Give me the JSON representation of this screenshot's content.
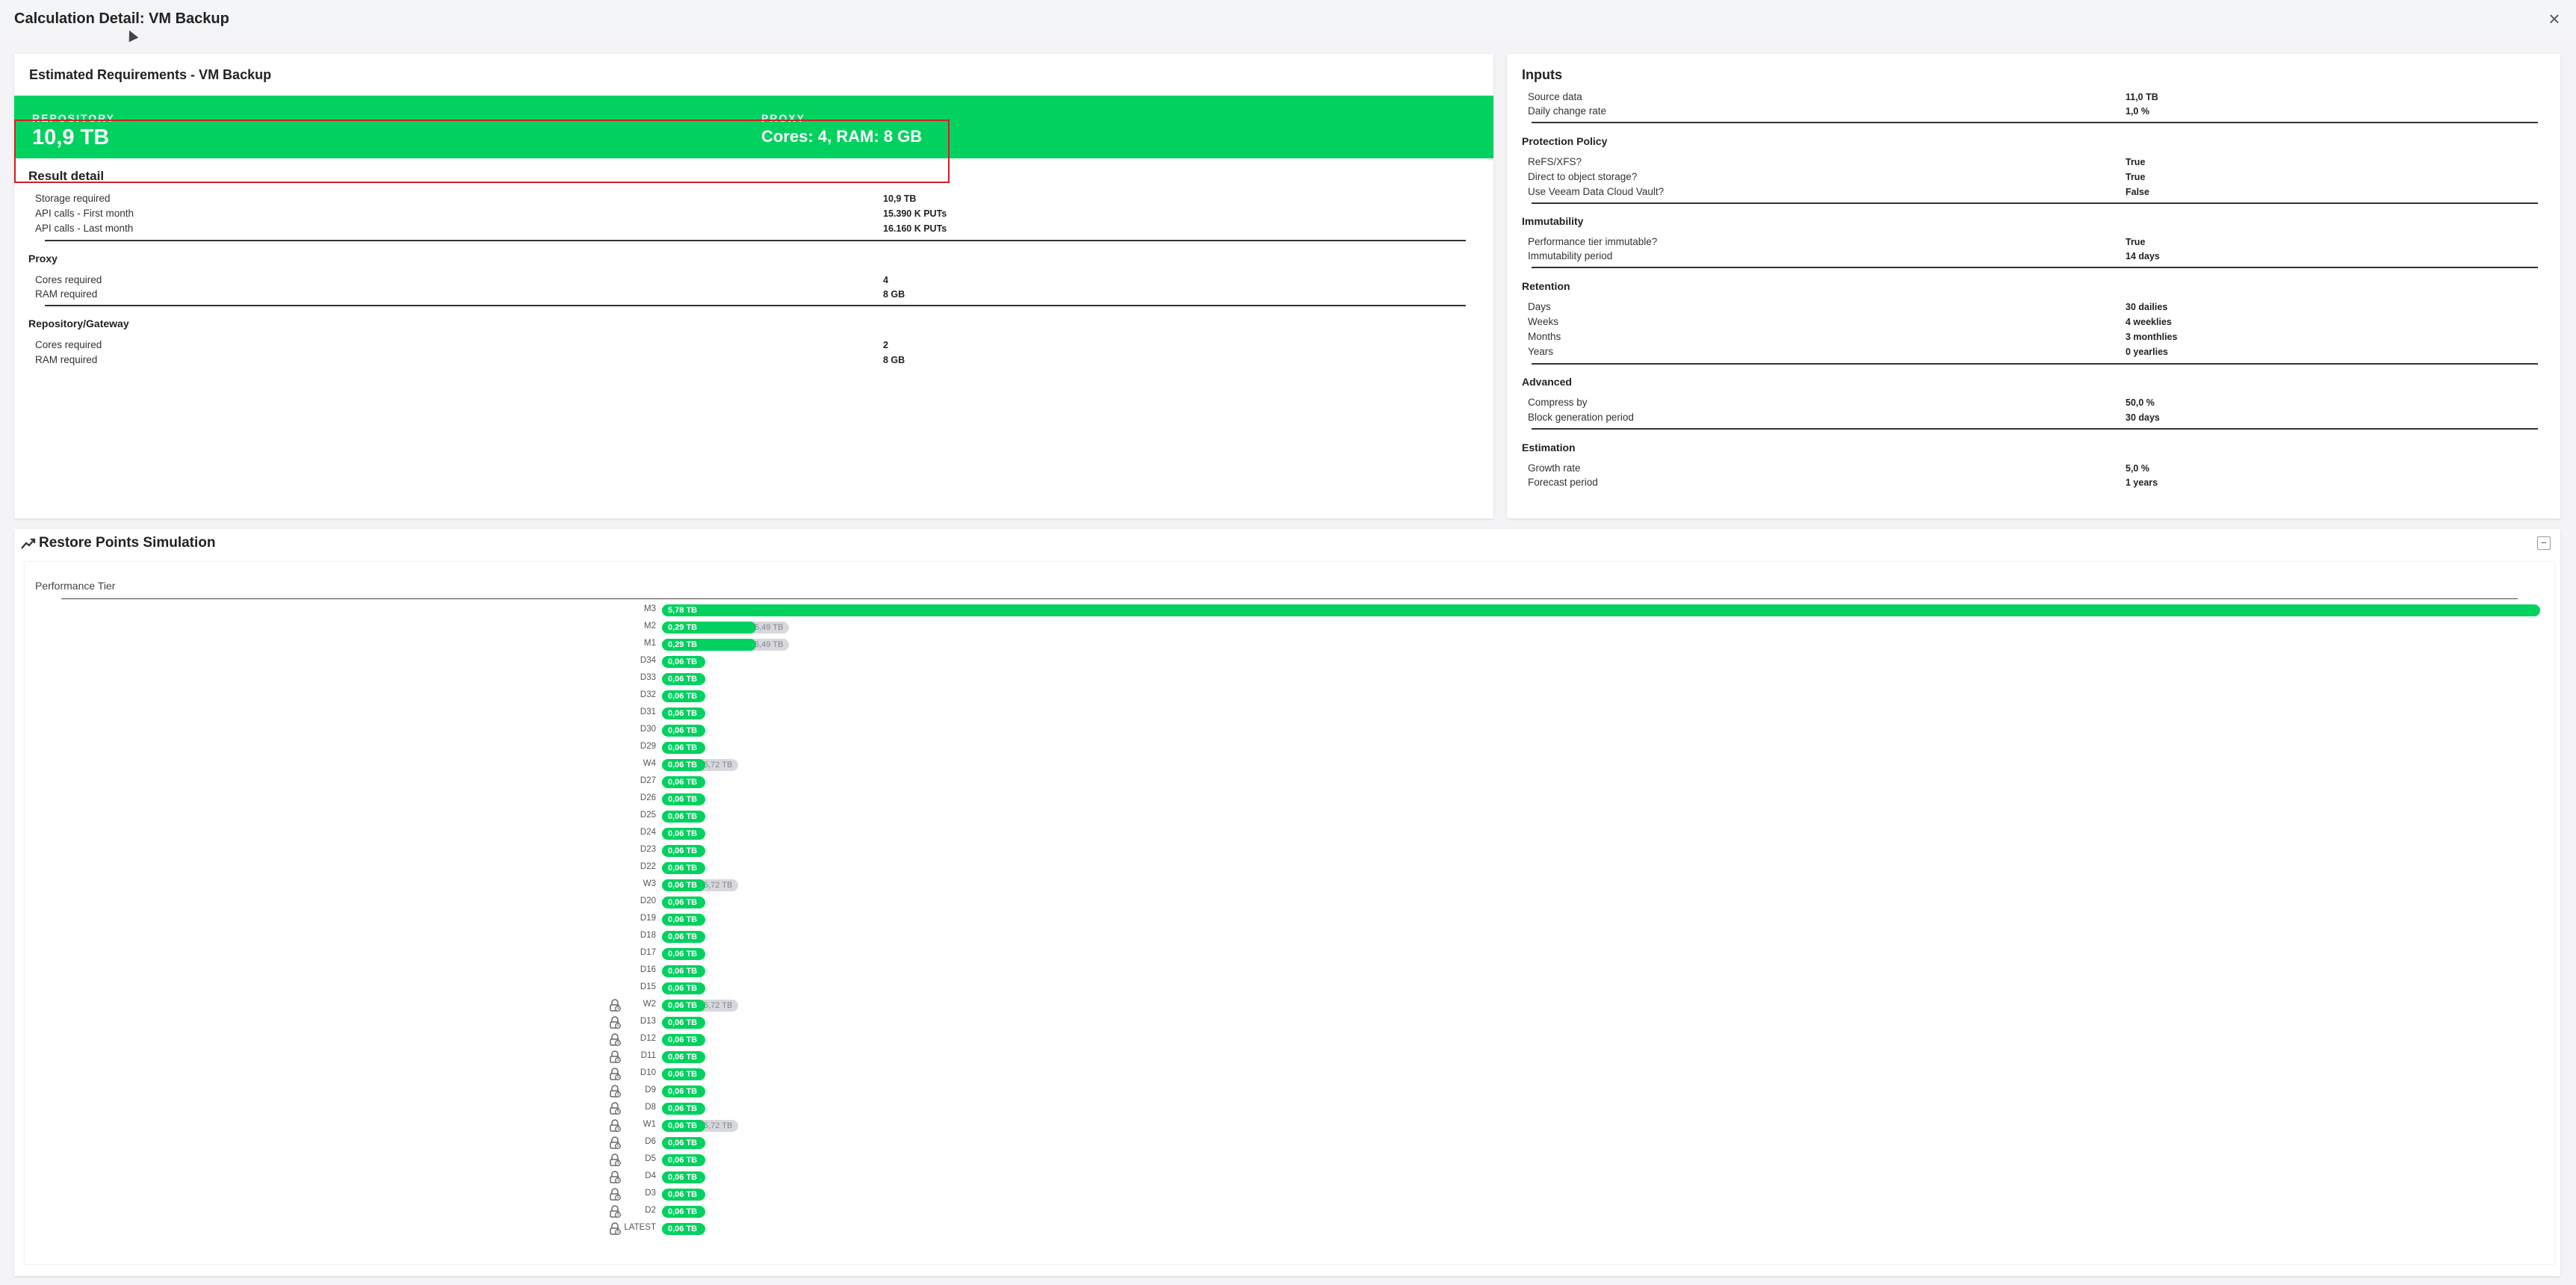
{
  "window": {
    "title": "Calculation Detail: VM Backup",
    "close_symbol": "×"
  },
  "left_card": {
    "title": "Estimated Requirements - VM Backup",
    "repository_label": "REPOSITORY",
    "repository_value": "10,9 TB",
    "proxy_label": "PROXY",
    "proxy_value": "Cores: 4, RAM: 8 GB",
    "result_detail": {
      "title": "Result detail",
      "rows": [
        {
          "label": "Storage required",
          "value": "10,9 TB"
        },
        {
          "label": "API calls - First month",
          "value": "15.390 K PUTs"
        },
        {
          "label": "API calls - Last month",
          "value": "16.160 K PUTs"
        }
      ]
    },
    "proxy_section": {
      "title": "Proxy",
      "rows": [
        {
          "label": "Cores required",
          "value": "4"
        },
        {
          "label": "RAM required",
          "value": "8 GB"
        }
      ]
    },
    "gateway_section": {
      "title": "Repository/Gateway",
      "rows": [
        {
          "label": "Cores required",
          "value": "2"
        },
        {
          "label": "RAM required",
          "value": "8 GB"
        }
      ]
    }
  },
  "inputs": {
    "title": "Inputs",
    "general": [
      {
        "label": "Source data",
        "value": "11,0 TB"
      },
      {
        "label": "Daily change rate",
        "value": "1,0 %"
      }
    ],
    "protection": {
      "title": "Protection Policy",
      "rows": [
        {
          "label": "ReFS/XFS?",
          "value": "True"
        },
        {
          "label": "Direct to object storage?",
          "value": "True"
        },
        {
          "label": "Use Veeam Data Cloud Vault?",
          "value": "False"
        }
      ]
    },
    "immutability": {
      "title": "Immutability",
      "rows": [
        {
          "label": "Performance tier immutable?",
          "value": "True"
        },
        {
          "label": "Immutability period",
          "value": "14 days"
        }
      ]
    },
    "retention": {
      "title": "Retention",
      "rows": [
        {
          "label": "Days",
          "value": "30 dailies"
        },
        {
          "label": "Weeks",
          "value": "4 weeklies"
        },
        {
          "label": "Months",
          "value": "3 monthlies"
        },
        {
          "label": "Years",
          "value": "0 yearlies"
        }
      ]
    },
    "advanced": {
      "title": "Advanced",
      "rows": [
        {
          "label": "Compress by",
          "value": "50,0 %"
        },
        {
          "label": "Block generation period",
          "value": "30 days"
        }
      ]
    },
    "estimation": {
      "title": "Estimation",
      "rows": [
        {
          "label": "Growth rate",
          "value": "5,0 %"
        },
        {
          "label": "Forecast period",
          "value": "1 years"
        }
      ]
    }
  },
  "simulation": {
    "title": "Restore Points Simulation",
    "collapse_symbol": "−",
    "tier_label": "Performance Tier",
    "full_size_tb": 5.78,
    "points": [
      {
        "label": "M3",
        "size": "5,78 TB",
        "size_tb": 5.78,
        "extra": "",
        "locked": false
      },
      {
        "label": "M2",
        "size": "0,29 TB",
        "size_tb": 0.29,
        "extra": "5,49 TB",
        "locked": false
      },
      {
        "label": "M1",
        "size": "0,29 TB",
        "size_tb": 0.29,
        "extra": "5,49 TB",
        "locked": false
      },
      {
        "label": "D34",
        "size": "0,06 TB",
        "size_tb": 0.06,
        "extra": "",
        "locked": false
      },
      {
        "label": "D33",
        "size": "0,06 TB",
        "size_tb": 0.06,
        "extra": "",
        "locked": false
      },
      {
        "label": "D32",
        "size": "0,06 TB",
        "size_tb": 0.06,
        "extra": "",
        "locked": false
      },
      {
        "label": "D31",
        "size": "0,06 TB",
        "size_tb": 0.06,
        "extra": "",
        "locked": false
      },
      {
        "label": "D30",
        "size": "0,06 TB",
        "size_tb": 0.06,
        "extra": "",
        "locked": false
      },
      {
        "label": "D29",
        "size": "0,06 TB",
        "size_tb": 0.06,
        "extra": "",
        "locked": false
      },
      {
        "label": "W4",
        "size": "0,06 TB",
        "size_tb": 0.06,
        "extra": "5,72 TB",
        "locked": false
      },
      {
        "label": "D27",
        "size": "0,06 TB",
        "size_tb": 0.06,
        "extra": "",
        "locked": false
      },
      {
        "label": "D26",
        "size": "0,06 TB",
        "size_tb": 0.06,
        "extra": "",
        "locked": false
      },
      {
        "label": "D25",
        "size": "0,06 TB",
        "size_tb": 0.06,
        "extra": "",
        "locked": false
      },
      {
        "label": "D24",
        "size": "0,06 TB",
        "size_tb": 0.06,
        "extra": "",
        "locked": false
      },
      {
        "label": "D23",
        "size": "0,06 TB",
        "size_tb": 0.06,
        "extra": "",
        "locked": false
      },
      {
        "label": "D22",
        "size": "0,06 TB",
        "size_tb": 0.06,
        "extra": "",
        "locked": false
      },
      {
        "label": "W3",
        "size": "0,06 TB",
        "size_tb": 0.06,
        "extra": "5,72 TB",
        "locked": false
      },
      {
        "label": "D20",
        "size": "0,06 TB",
        "size_tb": 0.06,
        "extra": "",
        "locked": false
      },
      {
        "label": "D19",
        "size": "0,06 TB",
        "size_tb": 0.06,
        "extra": "",
        "locked": false
      },
      {
        "label": "D18",
        "size": "0,06 TB",
        "size_tb": 0.06,
        "extra": "",
        "locked": false
      },
      {
        "label": "D17",
        "size": "0,06 TB",
        "size_tb": 0.06,
        "extra": "",
        "locked": false
      },
      {
        "label": "D16",
        "size": "0,06 TB",
        "size_tb": 0.06,
        "extra": "",
        "locked": false
      },
      {
        "label": "D15",
        "size": "0,06 TB",
        "size_tb": 0.06,
        "extra": "",
        "locked": false
      },
      {
        "label": "W2",
        "size": "0,06 TB",
        "size_tb": 0.06,
        "extra": "5,72 TB",
        "locked": true
      },
      {
        "label": "D13",
        "size": "0,06 TB",
        "size_tb": 0.06,
        "extra": "",
        "locked": true
      },
      {
        "label": "D12",
        "size": "0,06 TB",
        "size_tb": 0.06,
        "extra": "",
        "locked": true
      },
      {
        "label": "D11",
        "size": "0,06 TB",
        "size_tb": 0.06,
        "extra": "",
        "locked": true
      },
      {
        "label": "D10",
        "size": "0,06 TB",
        "size_tb": 0.06,
        "extra": "",
        "locked": true
      },
      {
        "label": "D9",
        "size": "0,06 TB",
        "size_tb": 0.06,
        "extra": "",
        "locked": true
      },
      {
        "label": "D8",
        "size": "0,06 TB",
        "size_tb": 0.06,
        "extra": "",
        "locked": true
      },
      {
        "label": "W1",
        "size": "0,06 TB",
        "size_tb": 0.06,
        "extra": "5,72 TB",
        "locked": true
      },
      {
        "label": "D6",
        "size": "0,06 TB",
        "size_tb": 0.06,
        "extra": "",
        "locked": true
      },
      {
        "label": "D5",
        "size": "0,06 TB",
        "size_tb": 0.06,
        "extra": "",
        "locked": true
      },
      {
        "label": "D4",
        "size": "0,06 TB",
        "size_tb": 0.06,
        "extra": "",
        "locked": true
      },
      {
        "label": "D3",
        "size": "0,06 TB",
        "size_tb": 0.06,
        "extra": "",
        "locked": true
      },
      {
        "label": "D2",
        "size": "0,06 TB",
        "size_tb": 0.06,
        "extra": "",
        "locked": true
      },
      {
        "label": "LATEST",
        "size": "0,06 TB",
        "size_tb": 0.06,
        "extra": "",
        "locked": true
      }
    ]
  },
  "colors": {
    "accent": "#00d15f",
    "highlight": "#d21f27",
    "pill_gray": "#d6d8dd"
  },
  "icons": {
    "close": "close-icon",
    "trend": "trend-up-icon",
    "lock": "lock-clock-icon",
    "collapse": "collapse-icon"
  }
}
